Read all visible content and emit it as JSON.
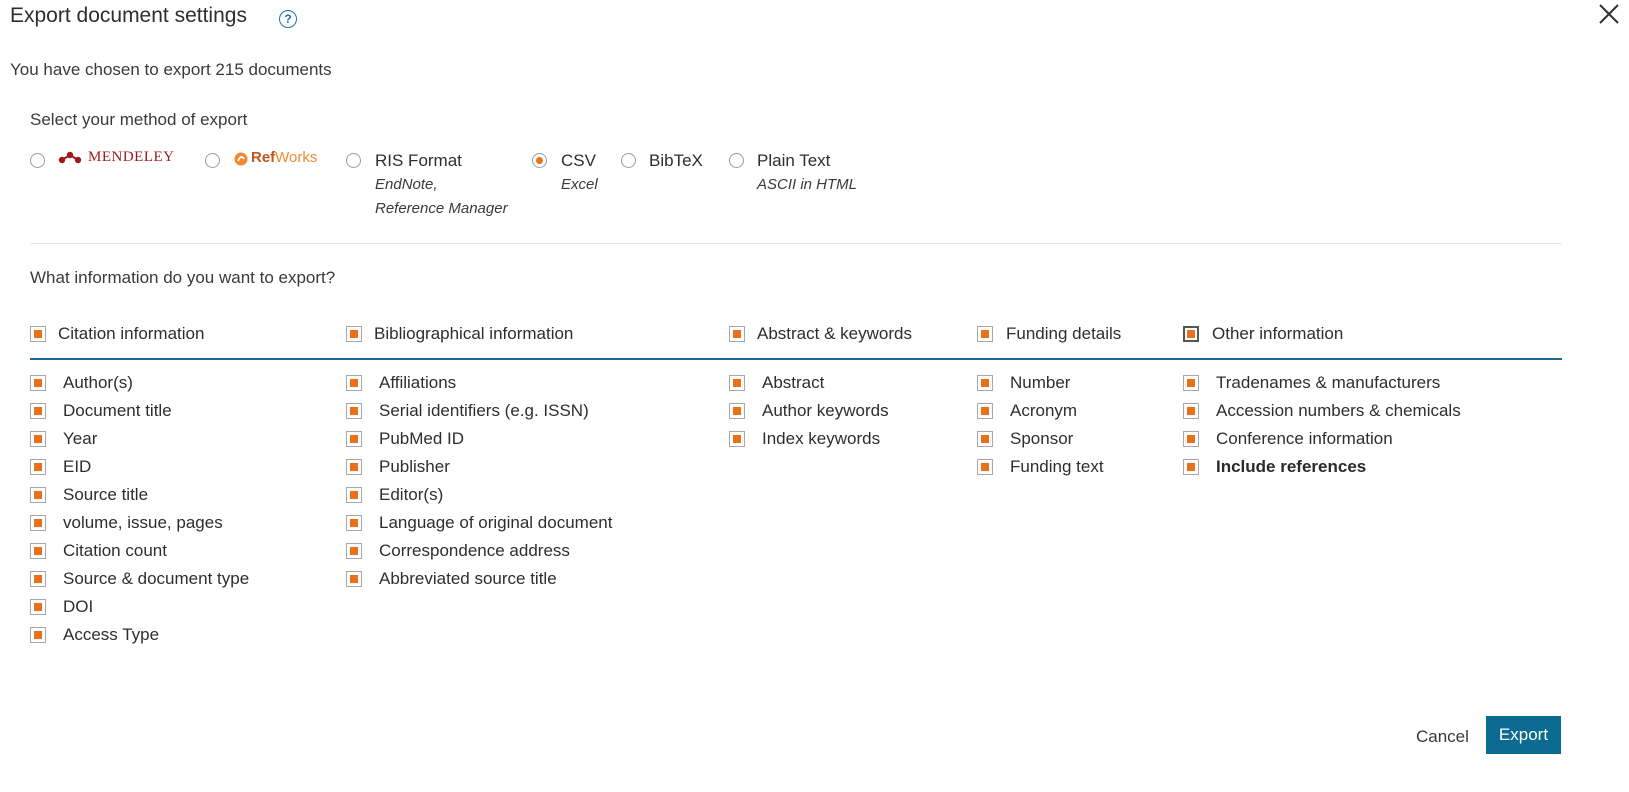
{
  "dialog": {
    "title": "Export document settings",
    "help_icon": "?",
    "subtitle": "You have chosen to export 215 documents"
  },
  "method": {
    "heading": "Select your method of export",
    "options": [
      {
        "id": "mendeley",
        "label": "MENDELEY",
        "selected": false
      },
      {
        "id": "refworks",
        "label_a": "Ref",
        "label_b": "Works",
        "selected": false
      },
      {
        "id": "ris",
        "label": "RIS Format",
        "sub1": "EndNote,",
        "sub2": "Reference Manager",
        "selected": false
      },
      {
        "id": "csv",
        "label": "CSV",
        "sub1": "Excel",
        "selected": true
      },
      {
        "id": "bibtex",
        "label": "BibTeX",
        "selected": false
      },
      {
        "id": "plaintext",
        "label": "Plain Text",
        "sub1": "ASCII in HTML",
        "selected": false
      }
    ]
  },
  "info": {
    "heading": "What information do you want to export?",
    "categories": [
      {
        "label": "Citation information",
        "checked": true,
        "items": [
          "Author(s)",
          "Document title",
          "Year",
          "EID",
          "Source title",
          "volume, issue, pages",
          "Citation count",
          "Source & document type",
          "DOI",
          "Access Type"
        ]
      },
      {
        "label": "Bibliographical information",
        "checked": true,
        "items": [
          "Affiliations",
          "Serial identifiers (e.g. ISSN)",
          "PubMed ID",
          "Publisher",
          "Editor(s)",
          "Language of original document",
          "Correspondence address",
          "Abbreviated source title"
        ]
      },
      {
        "label": "Abstract & keywords",
        "checked": true,
        "items": [
          "Abstract",
          "Author keywords",
          "Index keywords"
        ]
      },
      {
        "label": "Funding details",
        "checked": true,
        "items": [
          "Number",
          "Acronym",
          "Sponsor",
          "Funding text"
        ]
      },
      {
        "label": "Other information",
        "checked": true,
        "items": [
          "Tradenames & manufacturers",
          "Accession numbers & chemicals",
          "Conference information",
          "Include references"
        ]
      }
    ]
  },
  "actions": {
    "cancel": "Cancel",
    "export": "Export"
  },
  "colors": {
    "accent": "#e9711c",
    "primary": "#0b6a8f"
  },
  "icons": {
    "help": "help-circle-icon",
    "close": "close-icon"
  }
}
